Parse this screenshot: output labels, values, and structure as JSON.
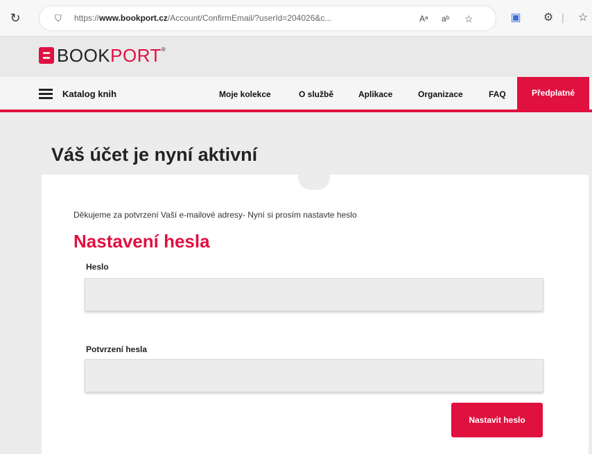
{
  "browser": {
    "url_prefix": "https://",
    "url_domain": "www.bookport.cz",
    "url_path": "/Account/ConfirmEmail/?userId=204026&c...",
    "read_aloud_label": "Aᵃ",
    "translate_label": "aᵇ"
  },
  "site": {
    "logo_book": "BOOK",
    "logo_port": "PORT",
    "logo_mark": "®"
  },
  "nav": {
    "catalog": "Katalog knih",
    "items": [
      "Moje kolekce",
      "O službě",
      "Aplikace",
      "Organizace",
      "FAQ"
    ],
    "subscription": "Předplatné"
  },
  "main": {
    "title": "Váš účet je nyní aktivní",
    "intro": "Děkujeme za potvrzení Vaší e-mailové adresy- Nyní si prosím nastavte heslo",
    "section_title": "Nastavení hesla",
    "password_label": "Heslo",
    "password_value": "",
    "confirm_label": "Potvrzení hesla",
    "confirm_value": "",
    "submit_label": "Nastavit heslo"
  },
  "colors": {
    "brand": "#e0103f"
  }
}
